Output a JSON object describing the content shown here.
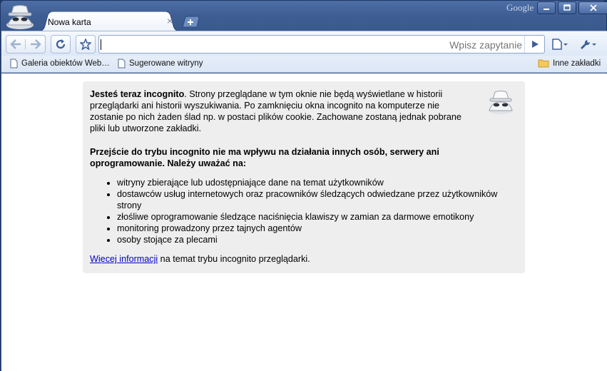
{
  "titlebar": {
    "brand": "Google"
  },
  "tab": {
    "title": "Nowa karta",
    "close_glyph": "×"
  },
  "window_controls": {
    "minimize": "minimize-icon",
    "maximize": "maximize-icon",
    "close": "close-icon"
  },
  "toolbar": {
    "back": "back-arrow-icon",
    "forward": "forward-arrow-icon",
    "reload": "reload-icon",
    "star": "star-icon",
    "omnibox": {
      "value": "",
      "hint": "Wpisz zapytanie"
    },
    "go": "play-icon",
    "page_menu": "page-menu-icon",
    "tools_menu": "wrench-icon"
  },
  "bookmarks": {
    "items": [
      {
        "label": "Galeria obiektów Web…",
        "icon": "page-icon"
      },
      {
        "label": "Sugerowane witryny",
        "icon": "page-icon"
      }
    ],
    "other": {
      "label": "Inne zakładki",
      "icon": "folder-icon"
    }
  },
  "incognito": {
    "intro_bold": "Jesteś teraz incognito",
    "intro_rest": ". Strony przeglądane w tym oknie nie będą wyświetlane w historii przeglądarki ani historii wyszukiwania. Po zamknięciu okna incognito na komputerze nie zostanie po nich żaden ślad np. w postaci plików cookie. Zachowane zostaną jednak pobrane pliki lub utworzone zakładki.",
    "warning": "Przejście do trybu incognito nie ma wpływu na działania innych osób, serwery ani oprogramowanie. Należy uważać na:",
    "bullets": [
      "witryny zbierające lub udostępniające dane na temat użytkowników",
      "dostawców usług internetowych oraz pracowników śledzących odwiedzane przez użytkowników strony",
      "złośliwe oprogramowanie śledzące naciśnięcia klawiszy w zamian za darmowe emotikony",
      "monitoring prowadzony przez tajnych agentów",
      "osoby stojące za plecami"
    ],
    "more_link": "Więcej informacji",
    "more_rest": " na temat trybu incognito przeglądarki."
  }
}
